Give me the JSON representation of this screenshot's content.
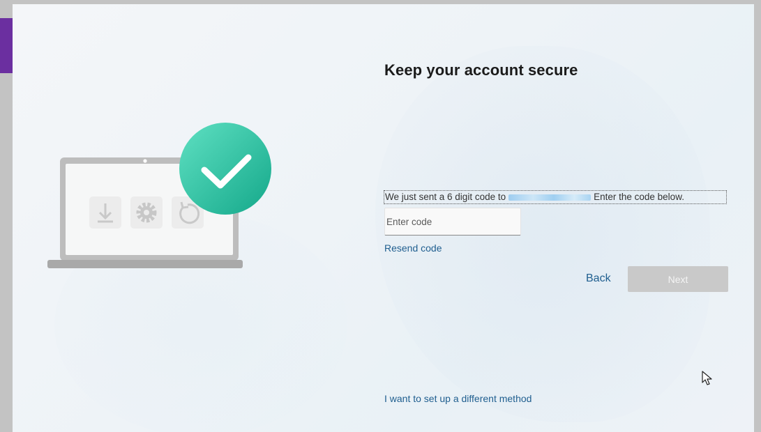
{
  "page": {
    "title": "Keep your account secure",
    "sent_prefix": "We just sent a 6 digit code to",
    "sent_suffix": "Enter the code below.",
    "code_input": {
      "placeholder": "Enter code",
      "value": ""
    },
    "resend_label": "Resend code",
    "back_label": "Back",
    "next_label": "Next",
    "different_method_label": "I want to set up a different method"
  },
  "illustration": {
    "icons": [
      "download-icon",
      "settings-gear-icon",
      "refresh-icon",
      "checkmark-icon"
    ]
  },
  "colors": {
    "accent_link": "#1f5e8f",
    "check_badge": "#2bbf9e",
    "next_disabled": "#c9c9c9",
    "side_tab": "#6b2fa0"
  }
}
